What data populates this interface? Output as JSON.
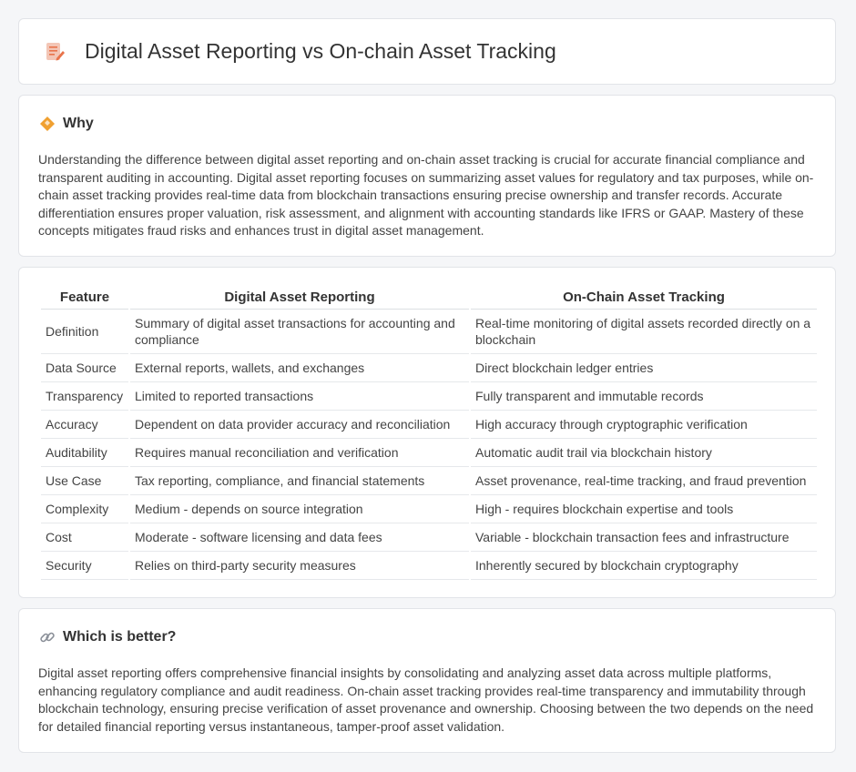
{
  "header": {
    "title": "Digital Asset Reporting vs On-chain Asset Tracking",
    "icon": "document-pencil-icon"
  },
  "why": {
    "heading": "Why",
    "icon": "diamond-icon",
    "text": "Understanding the difference between digital asset reporting and on-chain asset tracking is crucial for accurate financial compliance and transparent auditing in accounting. Digital asset reporting focuses on summarizing asset values for regulatory and tax purposes, while on-chain asset tracking provides real-time data from blockchain transactions ensuring precise ownership and transfer records. Accurate differentiation ensures proper valuation, risk assessment, and alignment with accounting standards like IFRS or GAAP. Mastery of these concepts mitigates fraud risks and enhances trust in digital asset management."
  },
  "table": {
    "headers": [
      "Feature",
      "Digital Asset Reporting",
      "On-Chain Asset Tracking"
    ],
    "rows": [
      [
        "Definition",
        "Summary of digital asset transactions for accounting and compliance",
        "Real-time monitoring of digital assets recorded directly on a blockchain"
      ],
      [
        "Data Source",
        "External reports, wallets, and exchanges",
        "Direct blockchain ledger entries"
      ],
      [
        "Transparency",
        "Limited to reported transactions",
        "Fully transparent and immutable records"
      ],
      [
        "Accuracy",
        "Dependent on data provider accuracy and reconciliation",
        "High accuracy through cryptographic verification"
      ],
      [
        "Auditability",
        "Requires manual reconciliation and verification",
        "Automatic audit trail via blockchain history"
      ],
      [
        "Use Case",
        "Tax reporting, compliance, and financial statements",
        "Asset provenance, real-time tracking, and fraud prevention"
      ],
      [
        "Complexity",
        "Medium - depends on source integration",
        "High - requires blockchain expertise and tools"
      ],
      [
        "Cost",
        "Moderate - software licensing and data fees",
        "Variable - blockchain transaction fees and infrastructure"
      ],
      [
        "Security",
        "Relies on third-party security measures",
        "Inherently secured by blockchain cryptography"
      ]
    ]
  },
  "better": {
    "heading": "Which is better?",
    "icon": "link-icon",
    "text": "Digital asset reporting offers comprehensive financial insights by consolidating and analyzing asset data across multiple platforms, enhancing regulatory compliance and audit readiness. On-chain asset tracking provides real-time transparency and immutability through blockchain technology, ensuring precise verification of asset provenance and ownership. Choosing between the two depends on the need for detailed financial reporting versus instantaneous, tamper-proof asset validation."
  },
  "colors": {
    "accent_icon": "#e8734a",
    "diamond_icon": "#f0a030"
  }
}
